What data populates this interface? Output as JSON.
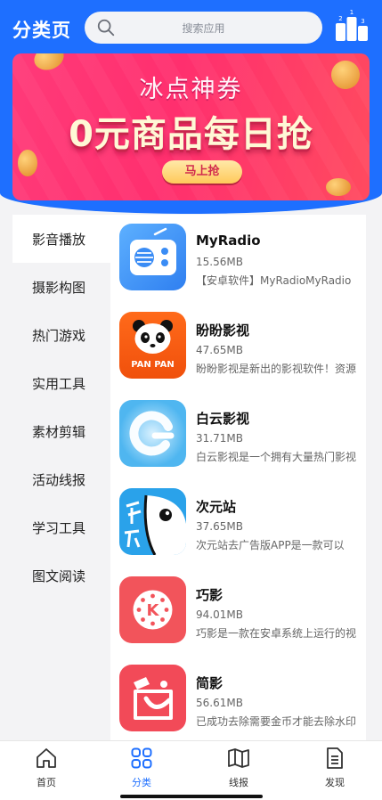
{
  "header": {
    "title": "分类页",
    "search_placeholder": "搜索应用",
    "rank_icon": "podium-icon"
  },
  "banner": {
    "top_text": "冰点神券",
    "main_text": "0元商品每日抢",
    "button_label": "马上抢"
  },
  "sidebar": {
    "items": [
      {
        "label": "影音播放",
        "active": true
      },
      {
        "label": "摄影构图"
      },
      {
        "label": "热门游戏"
      },
      {
        "label": "实用工具"
      },
      {
        "label": "素材剪辑"
      },
      {
        "label": "活动线报"
      },
      {
        "label": "学习工具"
      },
      {
        "label": "图文阅读"
      }
    ]
  },
  "apps": [
    {
      "name": "MyRadio",
      "size": "15.56MB",
      "desc": "【安卓软件】MyRadioMyRadio",
      "icon": "radio-icon"
    },
    {
      "name": "盼盼影视",
      "size": "47.65MB",
      "desc": "盼盼影视是新出的影视软件！资源",
      "icon": "panda-icon"
    },
    {
      "name": "白云影视",
      "size": "31.71MB",
      "desc": "白云影视是一个拥有大量热门影视",
      "icon": "cloud-icon"
    },
    {
      "name": "次元站",
      "size": "37.65MB",
      "desc": "次元站去广告版APP是一款可以",
      "icon": "anime-icon"
    },
    {
      "name": "巧影",
      "size": "94.01MB",
      "desc": "巧影是一款在安卓系统上运行的视",
      "icon": "kinemaster-icon"
    },
    {
      "name": "简影",
      "size": "56.61MB",
      "desc": "已成功去除需要金币才能去除水印",
      "icon": "clapper-icon"
    }
  ],
  "tabbar": {
    "tabs": [
      {
        "label": "首页",
        "icon": "home-icon"
      },
      {
        "label": "分类",
        "icon": "grid-icon",
        "active": true
      },
      {
        "label": "线报",
        "icon": "map-icon"
      },
      {
        "label": "发现",
        "icon": "document-icon"
      }
    ]
  },
  "colors": {
    "accent": "#1e6fff",
    "banner": "#ff2f6e"
  }
}
